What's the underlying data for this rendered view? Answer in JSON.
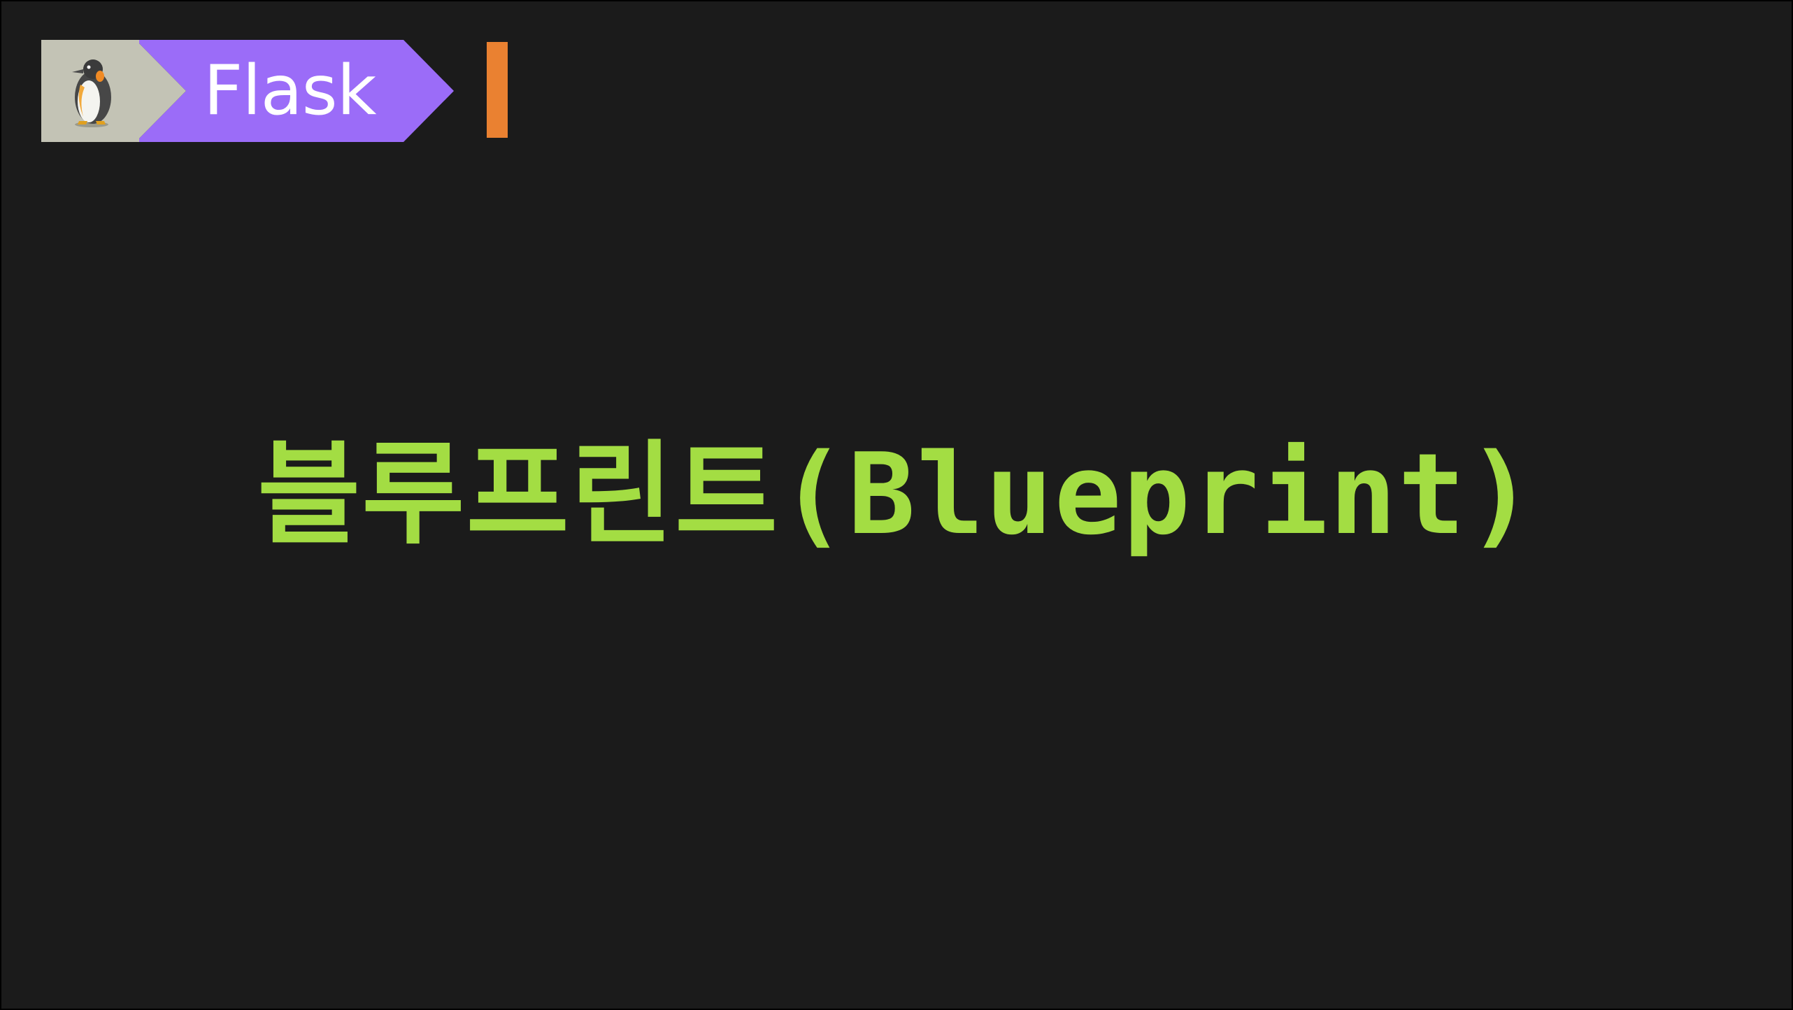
{
  "header": {
    "tag_label": "Flask",
    "tag_icon": "penguin-icon"
  },
  "main": {
    "title": "블루프린트(Blueprint)"
  },
  "colors": {
    "background": "#1b1b1b",
    "tag_purple": "#9b6cf8",
    "tag_icon_bg": "#c3c3b5",
    "cursor_orange": "#ea8131",
    "title_green": "#a3dd43",
    "tag_text": "#ffffff"
  }
}
